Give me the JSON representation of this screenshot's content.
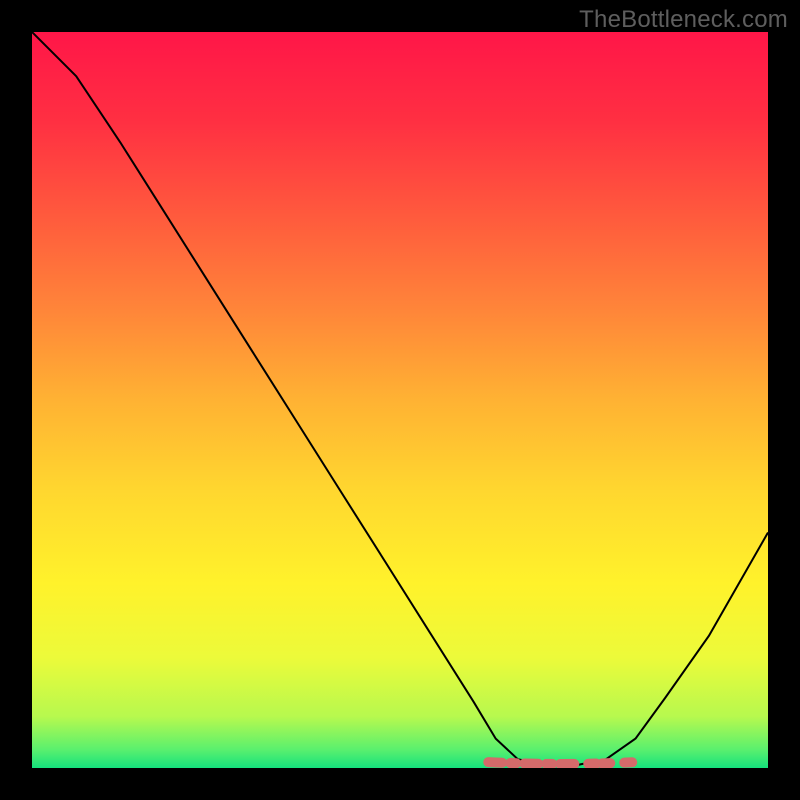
{
  "watermark": "TheBottleneck.com",
  "chart_data": {
    "type": "line",
    "title": "",
    "xlabel": "",
    "ylabel": "",
    "x_range": [
      0,
      100
    ],
    "y_range": [
      0,
      100
    ],
    "series": [
      {
        "name": "bottleneck-curve",
        "x": [
          0,
          6,
          12,
          18,
          24,
          30,
          36,
          42,
          48,
          54,
          60,
          63,
          66,
          70,
          74,
          78,
          82,
          86,
          92,
          100
        ],
        "y": [
          100,
          94,
          85,
          75.5,
          66,
          56.5,
          47,
          37.5,
          28,
          18.5,
          9,
          4,
          1.2,
          0.4,
          0.4,
          1.2,
          4,
          9.5,
          18,
          32
        ]
      }
    ],
    "valley_band": {
      "name": "optimal-range-marker",
      "x_start": 62,
      "x_end": 82,
      "y": 0.8,
      "color": "#d46a6a"
    },
    "gradient_stops": [
      {
        "offset": 0.0,
        "color": "#ff1648"
      },
      {
        "offset": 0.12,
        "color": "#ff2f42"
      },
      {
        "offset": 0.25,
        "color": "#ff5a3d"
      },
      {
        "offset": 0.38,
        "color": "#ff8639"
      },
      {
        "offset": 0.5,
        "color": "#ffb233"
      },
      {
        "offset": 0.62,
        "color": "#ffd62f"
      },
      {
        "offset": 0.75,
        "color": "#fff22b"
      },
      {
        "offset": 0.85,
        "color": "#ecfa3a"
      },
      {
        "offset": 0.93,
        "color": "#b7f94e"
      },
      {
        "offset": 0.975,
        "color": "#5af06e"
      },
      {
        "offset": 1.0,
        "color": "#15e27d"
      }
    ]
  }
}
